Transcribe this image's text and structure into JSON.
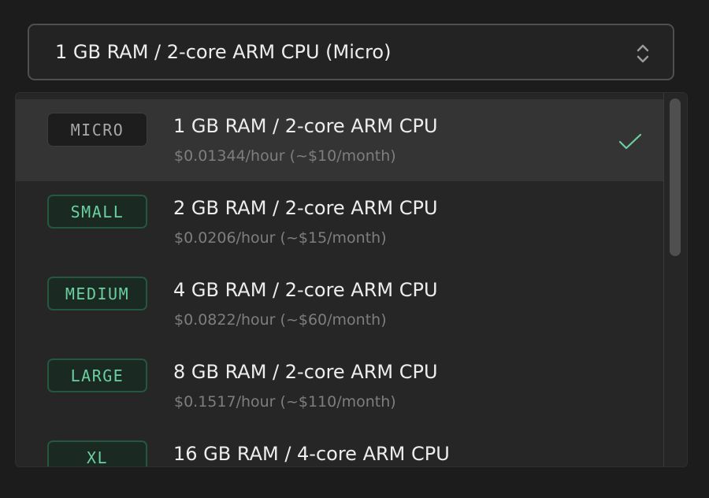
{
  "select": {
    "value": "1 GB RAM / 2-core ARM CPU (Micro)",
    "icon": "chevron-up-down-icon"
  },
  "options": [
    {
      "badge": "MICRO",
      "title": "1 GB RAM / 2-core ARM CPU",
      "price": "$0.01344/hour (~$10/month)",
      "selected": true
    },
    {
      "badge": "SMALL",
      "title": "2 GB RAM / 2-core ARM CPU",
      "price": "$0.0206/hour (~$15/month)",
      "selected": false
    },
    {
      "badge": "MEDIUM",
      "title": "4 GB RAM / 2-core ARM CPU",
      "price": "$0.0822/hour (~$60/month)",
      "selected": false
    },
    {
      "badge": "LARGE",
      "title": "8 GB RAM / 2-core ARM CPU",
      "price": "$0.1517/hour (~$110/month)",
      "selected": false
    },
    {
      "badge": "XL",
      "title": "16 GB RAM / 4-core ARM CPU",
      "price": "",
      "selected": false
    }
  ],
  "colors": {
    "background": "#1c1c1c",
    "dropdown": "#262626",
    "selected_row": "#343434",
    "accent_green": "#6ccf9f",
    "badge_green_border": "#24573f",
    "text_primary": "#ededed",
    "text_muted": "#7e7e7e"
  }
}
